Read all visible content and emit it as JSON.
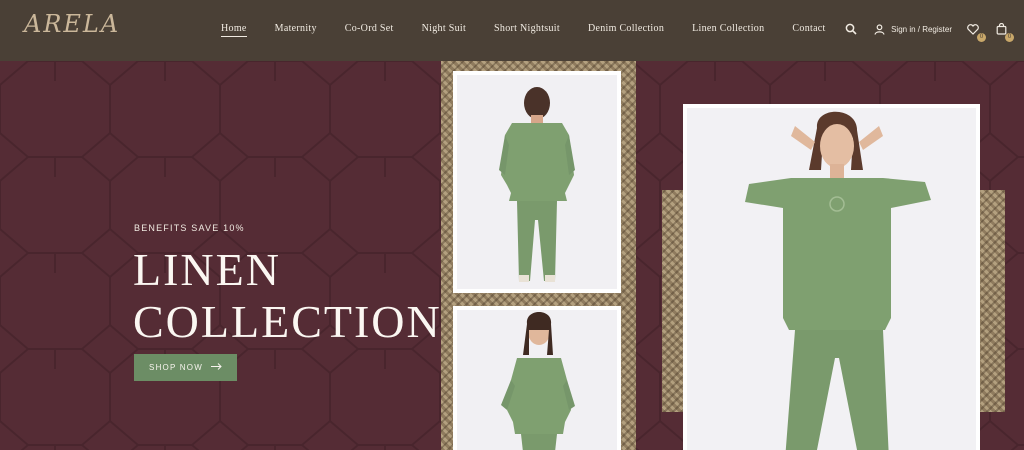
{
  "brand": {
    "logo_text": "ARELA"
  },
  "nav": {
    "items": [
      {
        "label": "Home",
        "active": true
      },
      {
        "label": "Maternity"
      },
      {
        "label": "Co-Ord Set"
      },
      {
        "label": "Night Suit"
      },
      {
        "label": "Short Nightsuit"
      },
      {
        "label": "Denim Collection"
      },
      {
        "label": "Linen Collection"
      },
      {
        "label": "Contact"
      }
    ]
  },
  "header_actions": {
    "search_icon": "search-icon",
    "signin_label": "Sign in / Register",
    "wishlist_count": "0",
    "cart_count": "0"
  },
  "hero": {
    "eyebrow": "BENEFITS SAVE 10%",
    "title_line1": "LINEN",
    "title_line2": "COLLECTION",
    "button_label": "SHOP NOW",
    "button_icon": "arrow-right-icon"
  },
  "colors": {
    "header_bg": "#4a4036",
    "hero_bg": "#552c35",
    "button_bg": "#6c8d65",
    "garment": "#7fa070"
  }
}
